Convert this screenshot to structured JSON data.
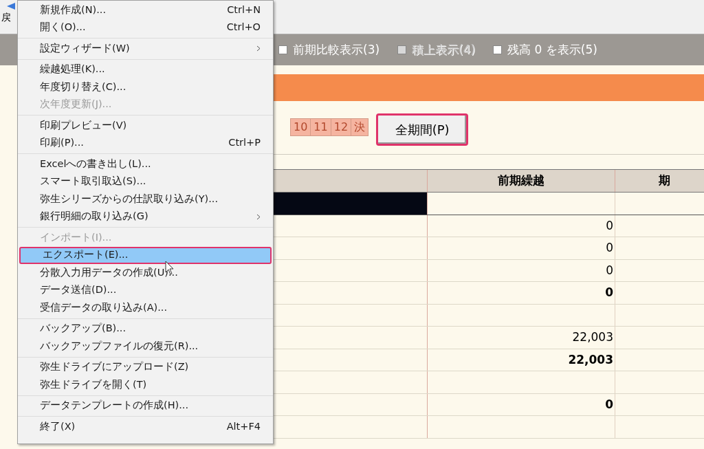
{
  "toolbar": {
    "back_label": "戻"
  },
  "options": [
    {
      "label": "前期比較表示(3)",
      "checked": false,
      "disabled": false
    },
    {
      "label": "積上表示(4)",
      "checked": false,
      "disabled": true
    },
    {
      "label": "残高 0 を表示(5)",
      "checked": false,
      "disabled": false
    }
  ],
  "period_tabs": [
    {
      "label": "10"
    },
    {
      "label": "11"
    },
    {
      "label": "12"
    },
    {
      "label": "決"
    }
  ],
  "full_period_button": {
    "label": "全期間(P)",
    "annotated": true
  },
  "table": {
    "columns": [
      "前期繰越",
      "期"
    ],
    "rows": [
      {
        "kind": "selected"
      },
      {
        "kind": "amount",
        "column_2": "0"
      },
      {
        "kind": "amount",
        "column_2": "0"
      },
      {
        "kind": "amount",
        "column_2": "0"
      },
      {
        "kind": "total",
        "column_2": "0"
      },
      {
        "kind": "blank"
      },
      {
        "kind": "amount",
        "column_2": "22,003"
      },
      {
        "kind": "total",
        "column_2": "22,003"
      },
      {
        "kind": "blank"
      },
      {
        "kind": "total",
        "column_2": "0"
      },
      {
        "kind": "blank"
      }
    ]
  },
  "menu": {
    "groups": [
      [
        {
          "label": "新規作成(N)...",
          "shortcut": "Ctrl+N",
          "submenu": false,
          "disabled": false,
          "selected": false
        },
        {
          "label": "開く(O)...",
          "shortcut": "Ctrl+O",
          "submenu": false,
          "disabled": false,
          "selected": false
        }
      ],
      [
        {
          "label": "設定ウィザード(W)",
          "submenu": true,
          "disabled": false,
          "selected": false
        }
      ],
      [
        {
          "label": "繰越処理(K)...",
          "submenu": false,
          "disabled": false,
          "selected": false
        },
        {
          "label": "年度切り替え(C)...",
          "submenu": false,
          "disabled": false,
          "selected": false
        },
        {
          "label": "次年度更新(J)...",
          "submenu": false,
          "disabled": true,
          "selected": false
        }
      ],
      [
        {
          "label": "印刷プレビュー(V)",
          "submenu": false,
          "disabled": false,
          "selected": false
        },
        {
          "label": "印刷(P)...",
          "shortcut": "Ctrl+P",
          "submenu": false,
          "disabled": false,
          "selected": false
        }
      ],
      [
        {
          "label": "Excelへの書き出し(L)...",
          "submenu": false,
          "disabled": false,
          "selected": false
        },
        {
          "label": "スマート取引取込(S)...",
          "submenu": false,
          "disabled": false,
          "selected": false
        },
        {
          "label": "弥生シリーズからの仕訳取り込み(Y)...",
          "submenu": false,
          "disabled": false,
          "selected": false
        },
        {
          "label": "銀行明細の取り込み(G)",
          "submenu": true,
          "disabled": false,
          "selected": false
        }
      ],
      [
        {
          "label": "インポート(I)...",
          "submenu": false,
          "disabled": true,
          "selected": false
        },
        {
          "label": "エクスポート(E)...",
          "submenu": false,
          "disabled": false,
          "selected": true
        },
        {
          "label": "分散入力用データの作成(U)...",
          "submenu": false,
          "disabled": false,
          "selected": false
        },
        {
          "label": "データ送信(D)...",
          "submenu": false,
          "disabled": false,
          "selected": false
        },
        {
          "label": "受信データの取り込み(A)...",
          "submenu": false,
          "disabled": false,
          "selected": false
        }
      ],
      [
        {
          "label": "バックアップ(B)...",
          "submenu": false,
          "disabled": false,
          "selected": false
        },
        {
          "label": "バックアップファイルの復元(R)...",
          "submenu": false,
          "disabled": false,
          "selected": false
        }
      ],
      [
        {
          "label": "弥生ドライブにアップロード(Z)",
          "submenu": false,
          "disabled": false,
          "selected": false
        },
        {
          "label": "弥生ドライブを開く(T)",
          "submenu": false,
          "disabled": false,
          "selected": false
        }
      ],
      [
        {
          "label": "データテンプレートの作成(H)...",
          "submenu": false,
          "disabled": false,
          "selected": false
        }
      ],
      [
        {
          "label": "終了(X)",
          "shortcut": "Alt+F4",
          "submenu": false,
          "disabled": false,
          "selected": false
        }
      ]
    ]
  }
}
